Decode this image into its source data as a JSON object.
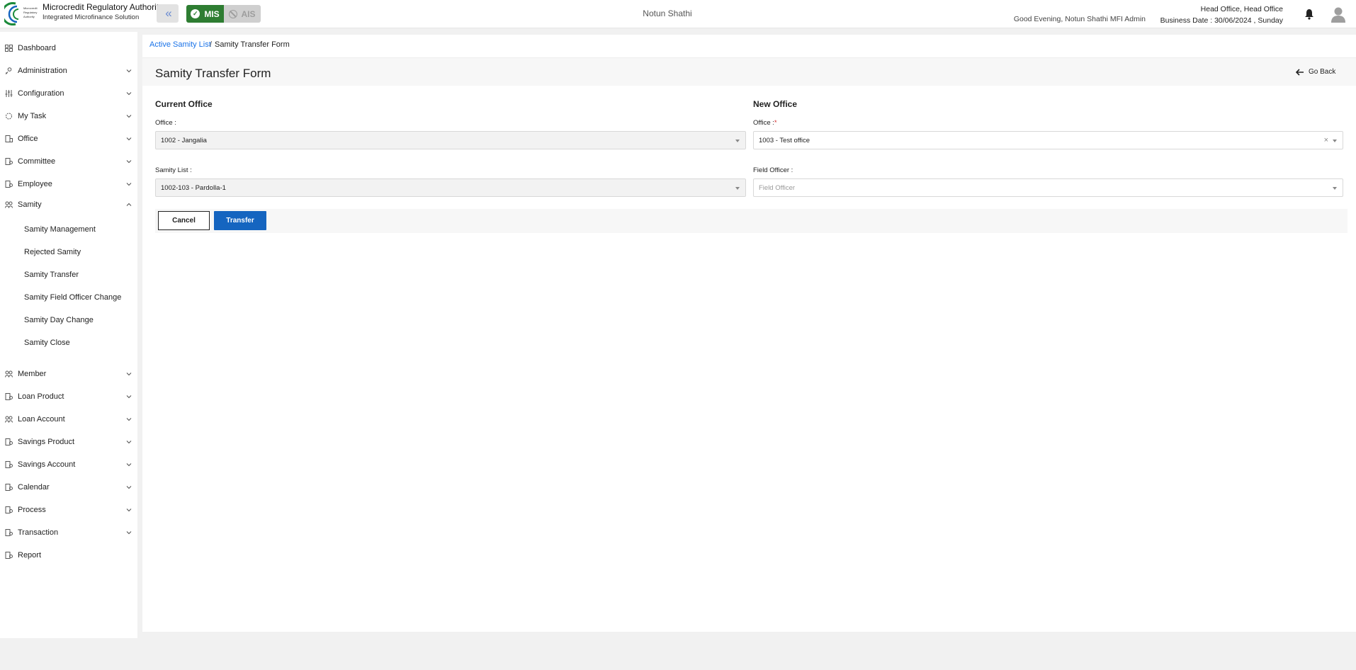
{
  "header": {
    "org_name": "Microcredit Regulatory Authority",
    "org_subtitle": "Integrated Microfinance Solution",
    "logo_text": [
      "Microcredit",
      "Regulatory",
      "Authority"
    ],
    "mode_active": "MIS",
    "mode_inactive": "AIS",
    "app_name": "Notun Shathi",
    "greeting": "Good Evening, Notun Shathi MFI Admin",
    "office": "Head Office, Head Office",
    "business_date": "Business Date : 30/06/2024 , Sunday",
    "accent_color": "#2e7d32"
  },
  "sidebar": {
    "items": [
      {
        "label": "Dashboard",
        "icon": "grid-icon",
        "expandable": false
      },
      {
        "label": "Administration",
        "icon": "admin-icon",
        "expandable": true
      },
      {
        "label": "Configuration",
        "icon": "sliders-icon",
        "expandable": true
      },
      {
        "label": "My Task",
        "icon": "task-icon",
        "expandable": true
      },
      {
        "label": "Office",
        "icon": "office-icon",
        "expandable": true
      },
      {
        "label": "Committee",
        "icon": "committee-icon",
        "expandable": true
      },
      {
        "label": "Employee",
        "icon": "employee-icon",
        "expandable": true
      },
      {
        "label": "Samity",
        "icon": "samity-icon",
        "expandable": true,
        "expanded": true
      },
      {
        "label": "Member",
        "icon": "member-icon",
        "expandable": true
      },
      {
        "label": "Loan Product",
        "icon": "loan-product-icon",
        "expandable": true
      },
      {
        "label": "Loan Account",
        "icon": "loan-account-icon",
        "expandable": true
      },
      {
        "label": "Savings Product",
        "icon": "savings-product-icon",
        "expandable": true
      },
      {
        "label": "Savings Account",
        "icon": "savings-account-icon",
        "expandable": true
      },
      {
        "label": "Calendar",
        "icon": "calendar-icon",
        "expandable": true
      },
      {
        "label": "Process",
        "icon": "process-icon",
        "expandable": true
      },
      {
        "label": "Transaction",
        "icon": "transaction-icon",
        "expandable": true
      },
      {
        "label": "Report",
        "icon": "report-icon",
        "expandable": false
      }
    ],
    "samity_sub": [
      "Samity Management",
      "Rejected Samity",
      "Samity Transfer",
      "Samity Field Officer Change",
      "Samity Day Change",
      "Samity Close"
    ]
  },
  "breadcrumb": {
    "link": "Active Samity List",
    "separator": "/",
    "current": "Samity Transfer Form"
  },
  "page": {
    "title": "Samity Transfer Form",
    "go_back": "Go Back"
  },
  "form": {
    "current_office": {
      "heading": "Current Office",
      "office_label": "Office :",
      "office_value": "1002 - Jangalia",
      "samity_label": "Samity List :",
      "samity_value": "1002-103 - Pardolla-1"
    },
    "new_office": {
      "heading": "New Office",
      "office_label": "Office :",
      "office_required": "*",
      "office_value": "1003 - Test office",
      "field_officer_label": "Field Officer :",
      "field_officer_placeholder": "Field Officer"
    },
    "cancel_label": "Cancel",
    "transfer_label": "Transfer",
    "primary_color": "#1565c0"
  }
}
